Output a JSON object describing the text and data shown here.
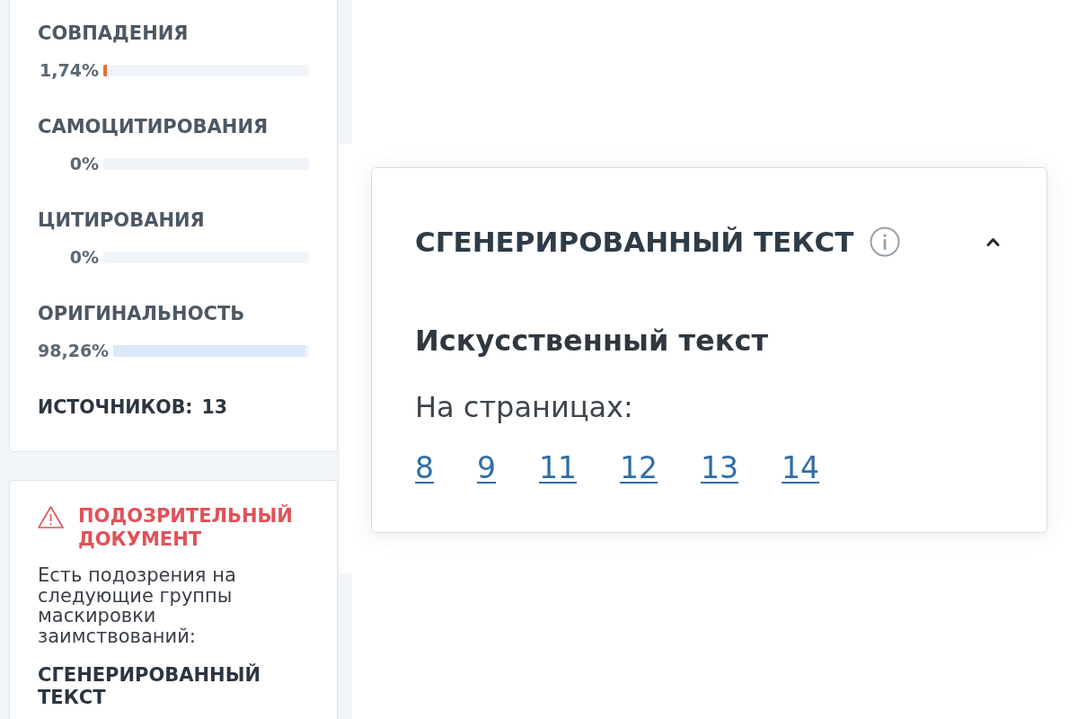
{
  "sidebar": {
    "metrics": [
      {
        "label": "СОВПАДЕНИЯ",
        "value": "1,74%",
        "level": 0.0174,
        "color": "#e2703a"
      },
      {
        "label": "САМОЦИТИРОВАНИЯ",
        "value": "0%"
      },
      {
        "label": "ЦИТИРОВАНИЯ",
        "value": "0%"
      },
      {
        "label": "ОРИГИНАЛЬНОСТЬ",
        "value": "98,26%",
        "level": 0.9826,
        "color": "#dbe8f8"
      }
    ],
    "sources": {
      "label": "ИСТОЧНИКОВ:",
      "count": "13"
    },
    "alert": {
      "title": "ПОДОЗРИТЕЛЬНЫЙ ДОКУМЕНТ",
      "text": "Есть подозрения на следующие группы маскировки заимствований:",
      "groups": [
        "СГЕНЕРИРОВАННЫЙ ТЕКСТ"
      ]
    }
  },
  "popover": {
    "title": "СГЕНЕРИРОВАННЫЙ ТЕКСТ",
    "expanded": true,
    "subtitle": "Искусственный текст",
    "pages_label": "На страницах:",
    "pages": [
      "8",
      "9",
      "11",
      "12",
      "13",
      "14"
    ]
  }
}
